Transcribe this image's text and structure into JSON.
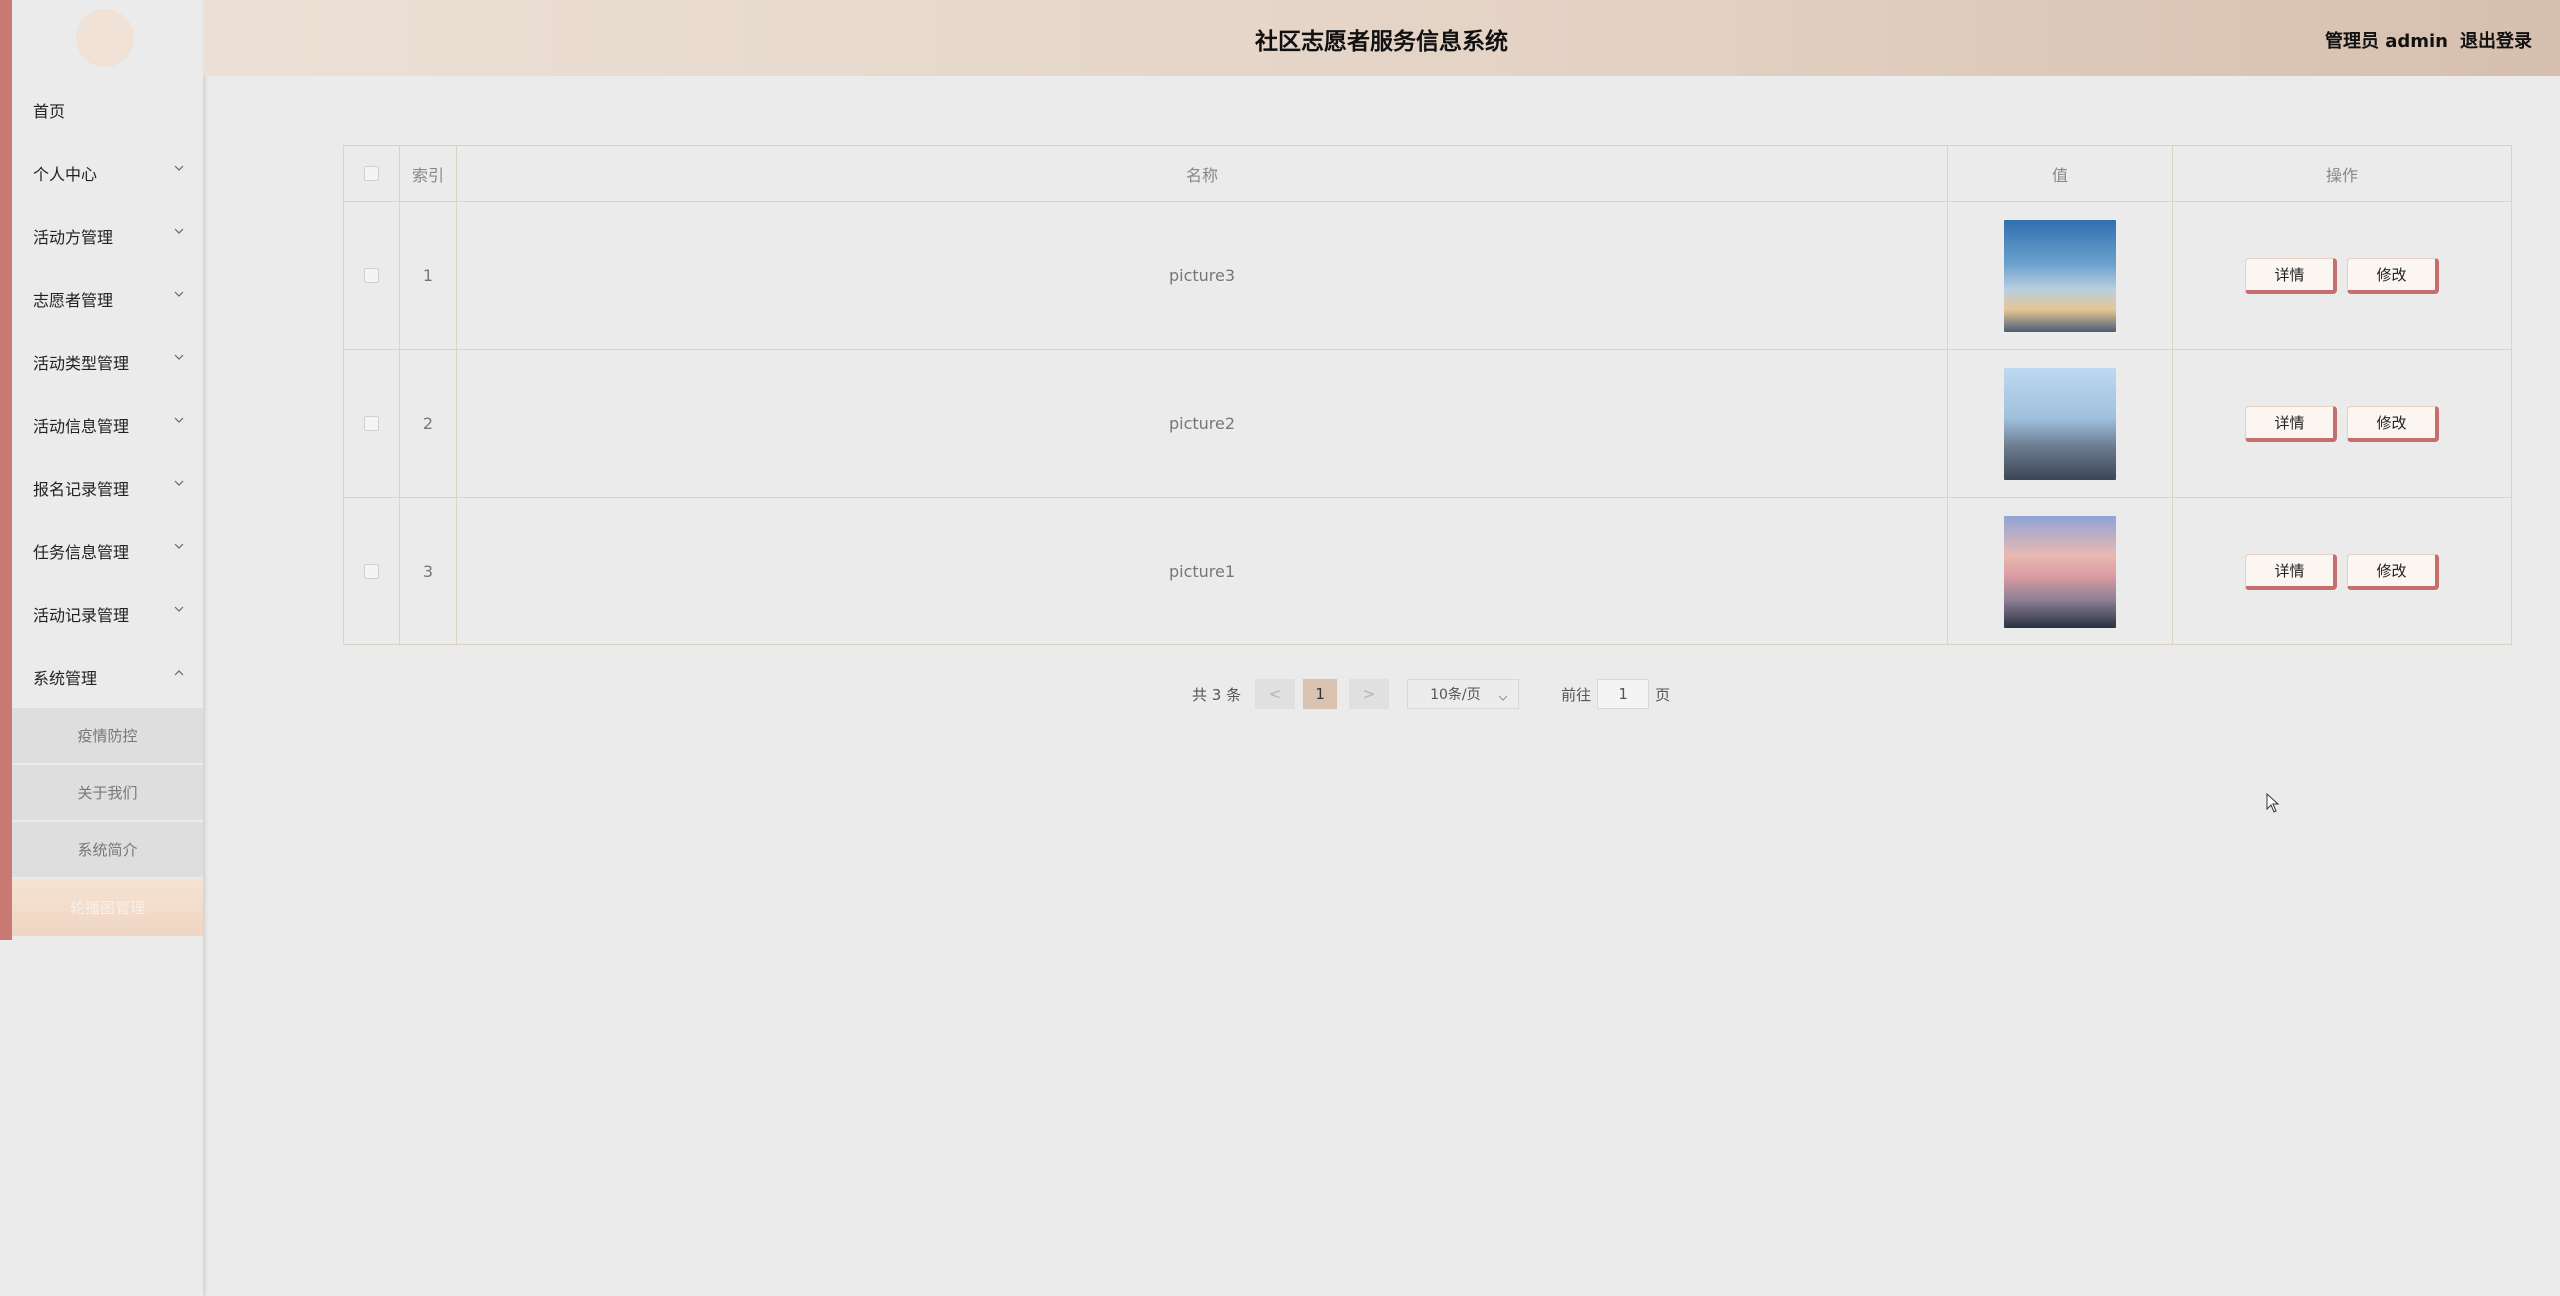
{
  "header": {
    "title": "社区志愿者服务信息系统",
    "user_label": "管理员 admin",
    "logout_label": "退出登录"
  },
  "sidebar": {
    "items": [
      {
        "label": "首页",
        "expandable": false
      },
      {
        "label": "个人中心",
        "expandable": true
      },
      {
        "label": "活动方管理",
        "expandable": true
      },
      {
        "label": "志愿者管理",
        "expandable": true
      },
      {
        "label": "活动类型管理",
        "expandable": true
      },
      {
        "label": "活动信息管理",
        "expandable": true
      },
      {
        "label": "报名记录管理",
        "expandable": true
      },
      {
        "label": "任务信息管理",
        "expandable": true
      },
      {
        "label": "活动记录管理",
        "expandable": true
      },
      {
        "label": "系统管理",
        "expandable": true,
        "expanded": true
      }
    ],
    "subitems": [
      {
        "label": "疫情防控"
      },
      {
        "label": "关于我们"
      },
      {
        "label": "系统简介"
      },
      {
        "label": "轮播图管理",
        "active": true
      }
    ]
  },
  "table": {
    "headers": {
      "index": "索引",
      "name": "名称",
      "value": "值",
      "ops": "操作"
    },
    "rows": [
      {
        "index": "1",
        "name": "picture3"
      },
      {
        "index": "2",
        "name": "picture2"
      },
      {
        "index": "3",
        "name": "picture1"
      }
    ],
    "detail_label": "详情",
    "edit_label": "修改"
  },
  "pagination": {
    "total": "共 3 条",
    "prev": "<",
    "next": ">",
    "current": "1",
    "page_size": "10条/页",
    "goto_label": "前往",
    "goto_value": "1",
    "page_suffix": "页"
  }
}
